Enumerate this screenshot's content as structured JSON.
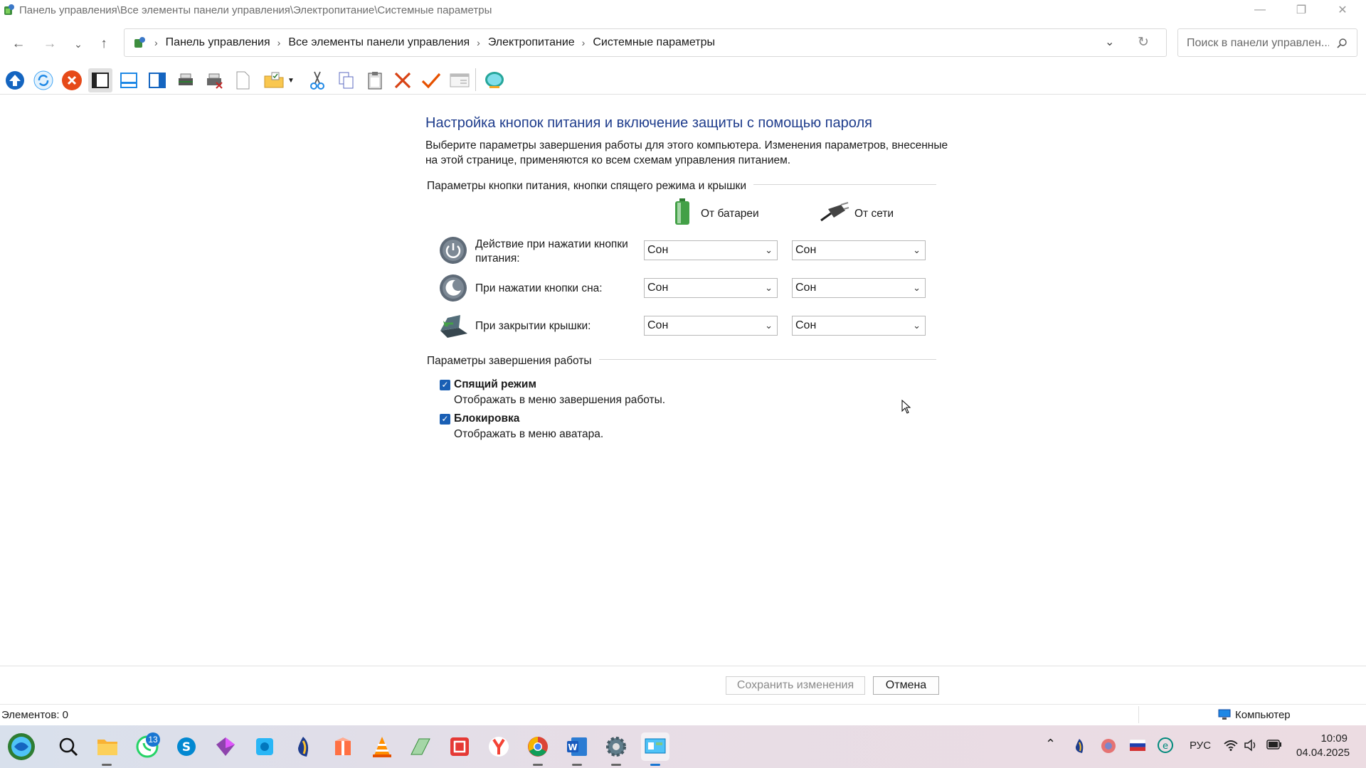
{
  "window": {
    "title": "Панель управления\\Все элементы панели управления\\Электропитание\\Системные параметры"
  },
  "address": {
    "breadcrumbs": [
      "Панель управления",
      "Все элементы панели управления",
      "Электропитание",
      "Системные параметры"
    ]
  },
  "search": {
    "placeholder": "Поиск в панели управлен..."
  },
  "page": {
    "heading": "Настройка кнопок питания и включение защиты с помощью пароля",
    "description": "Выберите параметры завершения работы для этого компьютера. Изменения параметров, внесенные на этой странице, применяются ко всем схемам управления питанием.",
    "section1_title": "Параметры кнопки питания, кнопки спящего режима и крышки",
    "col_battery": "От батареи",
    "col_plugged": "От сети",
    "rows": [
      {
        "label": "Действие при нажатии кнопки питания:",
        "battery": "Сон",
        "plugged": "Сон"
      },
      {
        "label": "При нажатии кнопки сна:",
        "battery": "Сон",
        "plugged": "Сон"
      },
      {
        "label": "При закрытии крышки:",
        "battery": "Сон",
        "plugged": "Сон"
      }
    ],
    "section2_title": "Параметры завершения работы",
    "options": [
      {
        "title": "Спящий режим",
        "desc": "Отображать в меню завершения работы.",
        "checked": true
      },
      {
        "title": "Блокировка",
        "desc": "Отображать в меню аватара.",
        "checked": true
      }
    ]
  },
  "buttons": {
    "save": "Сохранить изменения",
    "cancel": "Отмена"
  },
  "status": {
    "items": "Элементов: 0",
    "location": "Компьютер"
  },
  "taskbar": {
    "whatsapp_badge": "13",
    "lang": "РУС",
    "time": "10:09",
    "date": "04.04.2025"
  },
  "colors": {
    "accent": "#1a5fb4",
    "heading": "#1e3c8c"
  }
}
